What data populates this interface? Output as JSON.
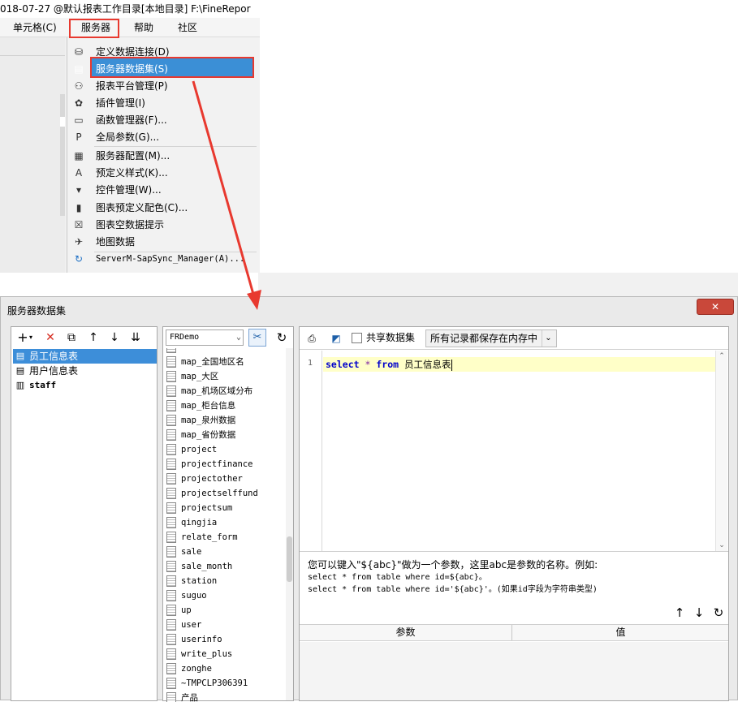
{
  "top_window": {
    "title": "018-07-27 @默认报表工作目录[本地目录]    F:\\FineRepor"
  },
  "menu_bar": {
    "items": [
      "单元格(C)",
      "服务器",
      "帮助",
      "社区"
    ]
  },
  "server_menu": {
    "items": [
      {
        "icon": "db-connect-icon",
        "glyph": "⛁",
        "label": "定义数据连接(D)"
      },
      {
        "icon": "server-dataset-icon",
        "glyph": "▤",
        "label": "服务器数据集(S)"
      },
      {
        "icon": "user-manage-icon",
        "glyph": "⚇",
        "label": "报表平台管理(P)"
      },
      {
        "icon": "plugin-icon",
        "glyph": "✿",
        "label": "插件管理(I)"
      },
      {
        "icon": "function-icon",
        "glyph": "▭",
        "label": "函数管理器(F)..."
      },
      {
        "icon": "param-icon",
        "glyph": "P",
        "label": "全局参数(G)..."
      },
      {
        "icon": "server-config-icon",
        "glyph": "▦",
        "label": "服务器配置(M)..."
      },
      {
        "icon": "style-icon",
        "glyph": "A",
        "label": "预定义样式(K)..."
      },
      {
        "icon": "widget-icon",
        "glyph": "▾",
        "label": "控件管理(W)..."
      },
      {
        "icon": "chart-color-icon",
        "glyph": "▮",
        "label": "图表预定义配色(C)..."
      },
      {
        "icon": "chart-empty-icon",
        "glyph": "☒",
        "label": "图表空数据提示"
      },
      {
        "icon": "map-icon",
        "glyph": "✈",
        "label": "地图数据"
      },
      {
        "icon": "sync-icon",
        "glyph": "↻",
        "label": "ServerM-SapSync_Manager(A)..."
      }
    ]
  },
  "dialog": {
    "title": "服务器数据集",
    "close_glyph": "✕",
    "toolbar_icons": [
      "add-icon",
      "delete-icon",
      "copy-icon",
      "move-up-icon",
      "move-down-icon",
      "sort-icon"
    ],
    "datasets": [
      {
        "label": "员工信息表",
        "icon": "dataset-icon",
        "glyph": "▤",
        "selected": true
      },
      {
        "label": "用户信息表",
        "icon": "dataset-icon",
        "glyph": "▤",
        "selected": false
      },
      {
        "label": "staff",
        "icon": "embedded-dataset-icon",
        "glyph": "▥",
        "selected": false
      }
    ],
    "db_connection": "FRDemo",
    "tables": [
      "map_全国地区名",
      "map_大区",
      "map_机场区域分布",
      "map_柜台信息",
      "map_泉州数据",
      "map_省份数据",
      "project",
      "projectfinance",
      "projectother",
      "projectselffund",
      "projectsum",
      "qingjia",
      "relate_form",
      "sale",
      "sale_month",
      "station",
      "suguo",
      "up",
      "user",
      "userinfo",
      "write_plus",
      "zonghe",
      "~TMPCLP306391",
      "产品"
    ],
    "share_dataset_label": "共享数据集",
    "cache_mode": "所有记录都保存在内存中",
    "sql": {
      "line_number": "1",
      "kw1": "select",
      "star": "*",
      "kw2": "from",
      "table": "员工信息表"
    },
    "hint": {
      "line1": "您可以键入\"${abc}\"做为一个参数，这里abc是参数的名称。例如:",
      "line2": "select * from table where id=${abc}。",
      "line3": "select * from table where id='${abc}'。(如果id字段为字符串类型)"
    },
    "param_columns": [
      "参数",
      "值"
    ]
  },
  "colors": {
    "highlight_red": "#e8392f",
    "selection_blue": "#3d8ed9",
    "sql_keyword": "#0000cc",
    "editor_line": "#ffffc8"
  }
}
